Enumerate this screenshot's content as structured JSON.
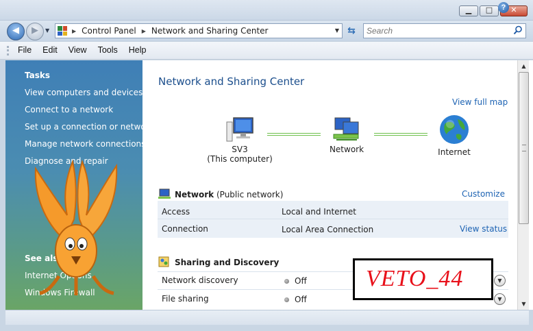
{
  "window": {
    "controls": {
      "minimize": "▁",
      "maximize": "□",
      "close": "✕"
    }
  },
  "address_bar": {
    "breadcrumbs": [
      "Control Panel",
      "Network and Sharing Center"
    ],
    "icon": "control-panel-icon"
  },
  "search": {
    "placeholder": "Search"
  },
  "menu": [
    "File",
    "Edit",
    "View",
    "Tools",
    "Help"
  ],
  "sidebar": {
    "tasks_heading": "Tasks",
    "tasks": [
      "View computers and devices",
      "Connect to a network",
      "Set up a connection or network",
      "Manage network connections",
      "Diagnose and repair"
    ],
    "see_also_heading": "See also",
    "see_also": [
      "Internet Options",
      "Windows Firewall"
    ]
  },
  "main": {
    "title": "Network and Sharing Center",
    "view_full_map": "View full map",
    "map": {
      "computer_name": "SV3",
      "computer_sub": "(This computer)",
      "network_label": "Network",
      "internet_label": "Internet"
    },
    "network_section": {
      "name": "Network",
      "type": "(Public network)",
      "customize": "Customize",
      "rows": [
        {
          "label": "Access",
          "value": "Local and Internet",
          "action": ""
        },
        {
          "label": "Connection",
          "value": "Local Area Connection",
          "action": "View status"
        }
      ]
    },
    "sharing_section": {
      "heading": "Sharing and Discovery",
      "rows": [
        {
          "label": "Network discovery",
          "value": "Off"
        },
        {
          "label": "File sharing",
          "value": "Off"
        }
      ]
    }
  },
  "watermark": "VETO_44",
  "colors": {
    "link": "#1d63b3",
    "title": "#1b4e8c",
    "watermark": "#e8101a",
    "sidebar_top": "#3f7fb6",
    "sidebar_bottom": "#6aa566"
  }
}
